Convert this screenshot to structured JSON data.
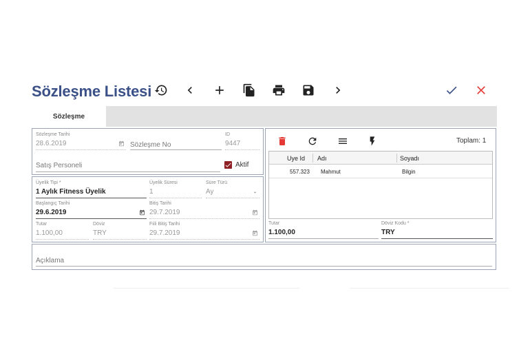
{
  "header": {
    "title": "Sözleşme Listesi"
  },
  "toolbar": {
    "icons": [
      "history-icon",
      "chevron-left-icon",
      "plus-icon",
      "copy-icon",
      "print-icon",
      "save-icon",
      "chevron-right-icon",
      "check-icon",
      "close-icon"
    ],
    "accent": "#3a5087",
    "close_color": "#e53935"
  },
  "tabs": [
    {
      "label": "Sözleşme"
    }
  ],
  "contract": {
    "date_label": "Sözleşme Tarihi",
    "date_value": "28.6.2019",
    "no_placeholder": "Sözleşme No",
    "id_label": "ID",
    "id_value": "9447",
    "personnel_placeholder": "Satış Personeli",
    "active_label": "Aktif"
  },
  "membership": {
    "type_label": "Üyelik Tipi *",
    "type_value": "1 Aylık Fitness Üyelik",
    "duration_label": "Üyelik Süresi",
    "duration_value": "1",
    "period_label": "Süre Türü",
    "period_value": "Ay",
    "start_label": "Başlangıç Tarihi",
    "start_value": "29.6.2019",
    "end_label": "Bitiş Tarihi",
    "end_value": "29.7.2019",
    "amount_label": "Tutar",
    "amount_value": "1.100,00",
    "currency_label": "Döviz",
    "currency_value": "TRY",
    "actual_end_label": "Fiili Bitiş Tarihi",
    "actual_end_value": "29.7.2019"
  },
  "members": {
    "total": "Toplam: 1",
    "columns": [
      "Uye Id",
      "Adı",
      "Soyadı"
    ],
    "rows": [
      {
        "id": "557.323",
        "name": "Mahmut",
        "surname": "Bilgin"
      }
    ],
    "amount_label": "Tutar",
    "amount_value": "1.100,00",
    "currency_label": "Döviz Kodu *",
    "currency_value": "TRY",
    "delete_color": "#e53935"
  },
  "notes": {
    "placeholder": "Açıklama"
  }
}
